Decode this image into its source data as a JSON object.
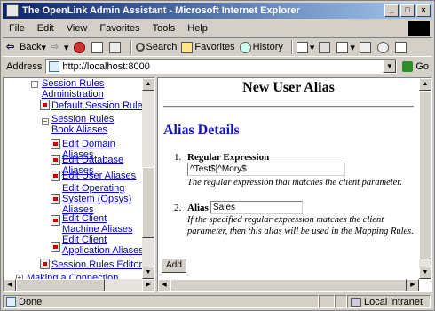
{
  "window": {
    "title": "The OpenLink Admin Assistant - Microsoft Internet Explorer",
    "controls": [
      "_",
      "□",
      "×"
    ]
  },
  "menu": [
    "File",
    "Edit",
    "View",
    "Favorites",
    "Tools",
    "Help"
  ],
  "toolbar": {
    "back": "Back",
    "search": "Search",
    "favorites": "Favorites",
    "history": "History"
  },
  "address": {
    "label": "Address",
    "url": "http://localhost:8000",
    "go": "Go"
  },
  "tree": {
    "session_rules_admin": "Session Rules Administration",
    "default_session_rules": "Default Session Rules",
    "session_rules_book_aliases": "Session Rules Book Aliases",
    "edit_domain_aliases": "Edit Domain Aliases",
    "edit_database_aliases": "Edit Database Aliases",
    "edit_user_aliases": "Edit User Aliases",
    "edit_os_aliases": "Edit Operating System (Opsys) Aliases",
    "edit_client_machine_aliases": "Edit Client Machine Aliases",
    "edit_client_application_aliases": "Edit Client Application Aliases",
    "session_rules_editor": "Session Rules Editor",
    "making_a_connection": "Making a Connection"
  },
  "main": {
    "title": "New User Alias",
    "section": "Alias Details",
    "item1_num": "1.",
    "item1_label": "Regular Expression",
    "item1_value": "^Test$|^Mory$",
    "item1_help": "The regular expression that matches the client parameter.",
    "item2_num": "2.",
    "item2_label": "Alias",
    "item2_value": "Sales",
    "item2_help": "If the specified regular expression matches the client parameter, then this alias will be used in the Mapping Rules.",
    "add_button": "Add"
  },
  "status": {
    "left": "Done",
    "zone": "Local intranet"
  }
}
